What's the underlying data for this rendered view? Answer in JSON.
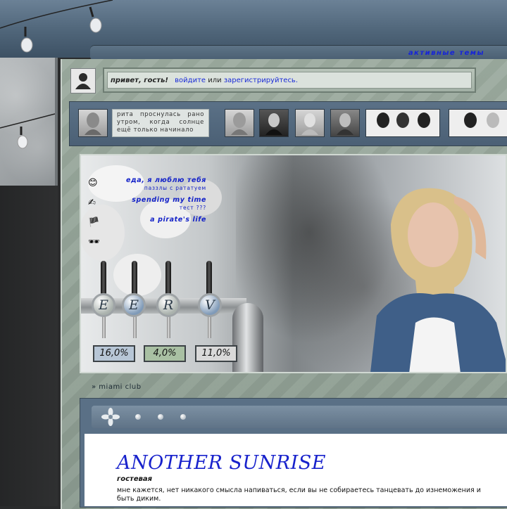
{
  "header": {
    "active_topics_label": "активные темы"
  },
  "greeting": {
    "hello": "привет, гость!",
    "login": "войдите",
    "or": "или",
    "register": "зарегистрируйтесь."
  },
  "strip": {
    "text": "рита проснулась рано утром, когда солнце ещё только начинало"
  },
  "topics": [
    {
      "icon": "😊",
      "title": "еда, я люблю тебя",
      "sub": "паззлы с рататуем"
    },
    {
      "icon": "✍",
      "title": "spending my time",
      "sub": "тест ???"
    },
    {
      "icon": "🏴",
      "title": "a pirate's life",
      "sub": ""
    },
    {
      "icon": "🕶",
      "title": "",
      "sub": ""
    }
  ],
  "taps": [
    {
      "letter": "E",
      "color": "#aab2ad"
    },
    {
      "letter": "E",
      "color": "#7f9ab8"
    },
    {
      "letter": "R",
      "color": "#aab2ad"
    },
    {
      "letter": "V",
      "color": "#7f9ab8"
    }
  ],
  "stats": [
    {
      "value": "16,0%",
      "color": "#b7c6d6"
    },
    {
      "value": "4,0%",
      "color": "#a9c0a3"
    },
    {
      "value": "11,0%",
      "color": "#d9d9d9"
    }
  ],
  "breadcrumb": "» miami club",
  "post": {
    "title": "ANOTHER SUNRISE",
    "subtitle": "гостевая",
    "text": "мне кажется, нет никакого смысла напиваться, если вы не собираетесь танцевать до изнеможения и быть диким."
  }
}
